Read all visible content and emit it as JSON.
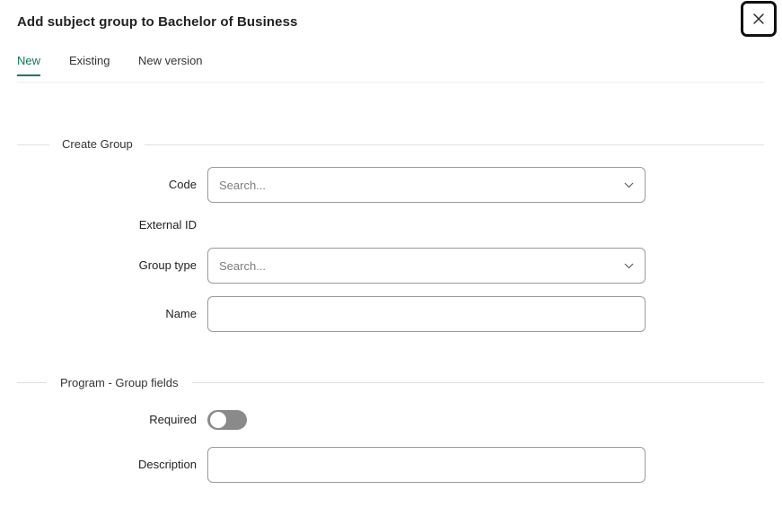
{
  "dialog": {
    "title": "Add subject group to Bachelor of Business",
    "close_icon": "close-icon"
  },
  "tabs": [
    {
      "label": "New",
      "active": true
    },
    {
      "label": "Existing",
      "active": false
    },
    {
      "label": "New version",
      "active": false
    }
  ],
  "create_group": {
    "section_title": "Create Group",
    "code": {
      "label": "Code",
      "placeholder": "Search..."
    },
    "external_id": {
      "label": "External ID",
      "value": ""
    },
    "group_type": {
      "label": "Group type",
      "placeholder": "Search..."
    },
    "name": {
      "label": "Name",
      "value": ""
    }
  },
  "program_group_fields": {
    "section_title": "Program - Group fields",
    "required": {
      "label": "Required",
      "checked": false
    },
    "description": {
      "label": "Description",
      "value": ""
    }
  },
  "colors": {
    "accent": "#0e7a55",
    "toggle_off": "#8a8a8a",
    "input_border": "#9a9a9a"
  }
}
